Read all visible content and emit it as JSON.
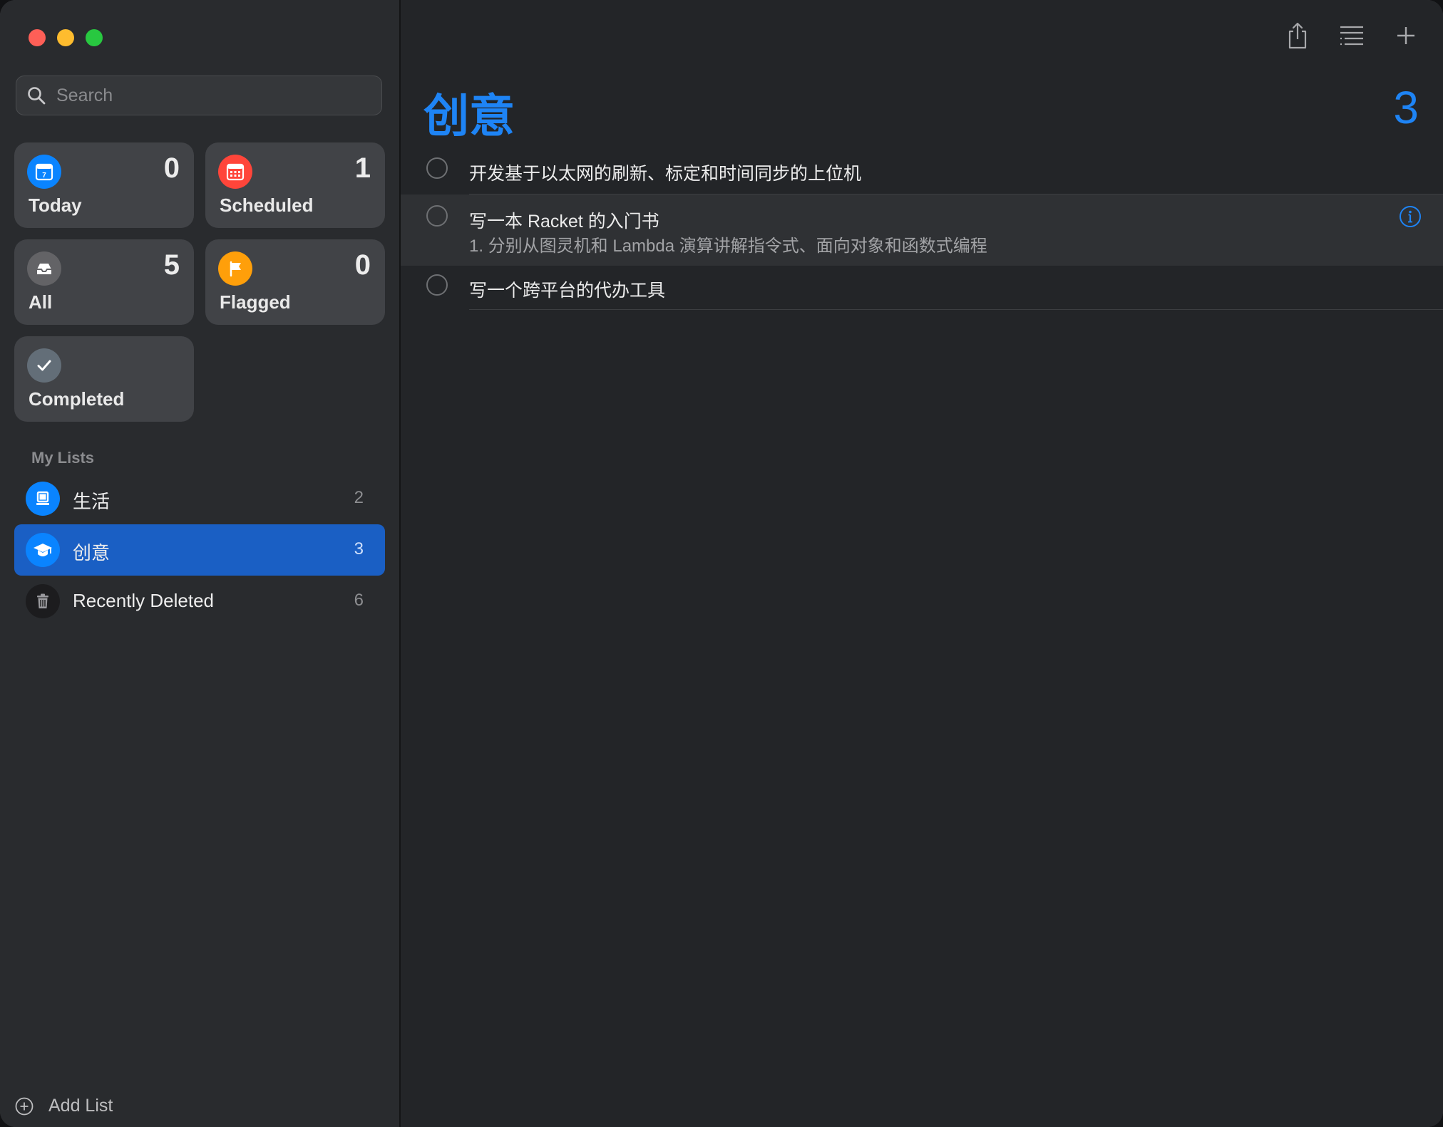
{
  "search": {
    "placeholder": "Search"
  },
  "smart_lists": [
    {
      "label": "Today",
      "count": "0",
      "icon": "calendar-today-icon",
      "color": "#0a84ff"
    },
    {
      "label": "Scheduled",
      "count": "1",
      "icon": "calendar-grid-icon",
      "color": "#ff453a"
    },
    {
      "label": "All",
      "count": "5",
      "icon": "tray-icon",
      "color": "#636366"
    },
    {
      "label": "Flagged",
      "count": "0",
      "icon": "flag-icon",
      "color": "#ff9f0a"
    },
    {
      "label": "Completed",
      "count": "",
      "icon": "checkmark-icon",
      "color": "#636e78"
    }
  ],
  "my_lists": {
    "header": "My Lists",
    "items": [
      {
        "name": "生活",
        "count": "2",
        "icon": "laptop-icon",
        "color": "#0a84ff"
      },
      {
        "name": "创意",
        "count": "3",
        "icon": "graduation-cap-icon",
        "color": "#0a84ff",
        "selected": true
      },
      {
        "name": "Recently Deleted",
        "count": "6",
        "icon": "trash-icon",
        "color": "#1c1c1e"
      }
    ]
  },
  "add_list_label": "Add List",
  "toolbar": {
    "icons": [
      "share-icon",
      "list-options-icon",
      "add-icon"
    ]
  },
  "current_list": {
    "title": "创意",
    "count": "3",
    "accent": "#1e84f5",
    "tasks": [
      {
        "title": "开发基于以太网的刷新、标定和时间同步的上位机",
        "note": ""
      },
      {
        "title": "写一本 Racket 的入门书",
        "note": "1. 分别从图灵机和 Lambda 演算讲解指令式、面向对象和函数式编程"
      },
      {
        "title": "写一个跨平台的代办工具",
        "note": ""
      }
    ]
  }
}
